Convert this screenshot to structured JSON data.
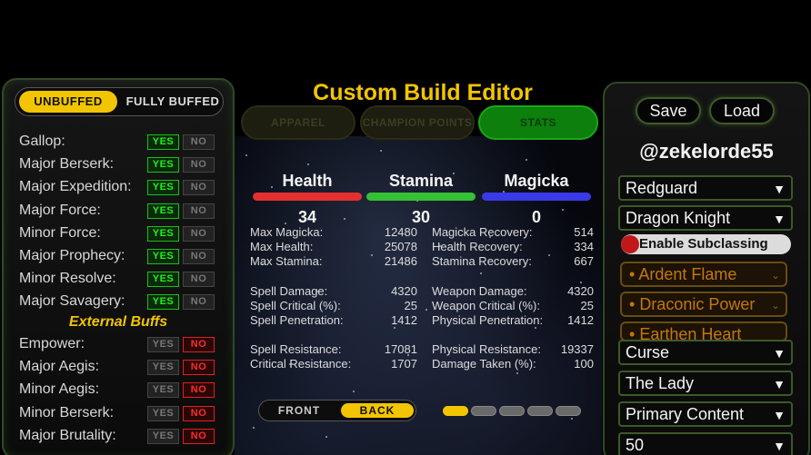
{
  "buff_mode": {
    "unbuffed": "UNBUFFED",
    "fully_buffed": "FULLY BUFFED"
  },
  "yes_label": "YES",
  "no_label": "NO",
  "major_buffs": [
    {
      "label": "Gallop:",
      "value": "yes"
    },
    {
      "label": "Major Berserk:",
      "value": "yes"
    },
    {
      "label": "Major Expedition:",
      "value": "yes"
    },
    {
      "label": "Major Force:",
      "value": "yes"
    },
    {
      "label": "Minor Force:",
      "value": "yes"
    },
    {
      "label": "Major Prophecy:",
      "value": "yes"
    },
    {
      "label": "Minor Resolve:",
      "value": "yes"
    },
    {
      "label": "Major Savagery:",
      "value": "yes"
    }
  ],
  "external_heading": "External Buffs",
  "external_buffs": [
    {
      "label": "Empower:",
      "value": "no"
    },
    {
      "label": "Major Aegis:",
      "value": "no"
    },
    {
      "label": "Minor Aegis:",
      "value": "no"
    },
    {
      "label": "Minor Berserk:",
      "value": "no"
    },
    {
      "label": "Major Brutality:",
      "value": "no"
    }
  ],
  "title": "Custom Build Editor",
  "tabs": [
    "APPAREL",
    "CHAMPION POINTS",
    "STATS"
  ],
  "active_tab": "STATS",
  "attributes": [
    {
      "name": "Health",
      "value": "34",
      "color": "#e53030"
    },
    {
      "name": "Stamina",
      "value": "30",
      "color": "#35c035"
    },
    {
      "name": "Magicka",
      "value": "0",
      "color": "#3a3ae8"
    }
  ],
  "stats_left": [
    [
      {
        "k": "Max Magicka:",
        "v": "12480"
      },
      {
        "k": "Max Health:",
        "v": "25078"
      },
      {
        "k": "Max Stamina:",
        "v": "21486"
      }
    ],
    [
      {
        "k": "Spell Damage:",
        "v": "4320"
      },
      {
        "k": "Spell Critical (%):",
        "v": "25"
      },
      {
        "k": "Spell Penetration:",
        "v": "1412"
      }
    ],
    [
      {
        "k": "Spell Resistance:",
        "v": "17081"
      },
      {
        "k": "Critical Resistance:",
        "v": "1707"
      }
    ]
  ],
  "stats_right": [
    [
      {
        "k": "Magicka Recovery:",
        "v": "514"
      },
      {
        "k": "Health Recovery:",
        "v": "334"
      },
      {
        "k": "Stamina Recovery:",
        "v": "667"
      }
    ],
    [
      {
        "k": "Weapon Damage:",
        "v": "4320"
      },
      {
        "k": "Weapon Critical (%):",
        "v": "25"
      },
      {
        "k": "Physical Penetration:",
        "v": "1412"
      }
    ],
    [
      {
        "k": "Physical Resistance:",
        "v": "19337"
      },
      {
        "k": "Damage Taken (%):",
        "v": "100"
      }
    ]
  ],
  "view_toggle": {
    "front": "FRONT",
    "back": "BACK",
    "selected": "BACK"
  },
  "pagination": {
    "pages": 5,
    "active": 1
  },
  "actions": {
    "save": "Save",
    "load": "Load"
  },
  "username": "@zekelorde55",
  "race": "Redguard",
  "class": "Dragon Knight",
  "subclassing_label": "Enable Subclassing",
  "skill_lines": [
    "Ardent Flame",
    "Draconic Power",
    "Earthen Heart"
  ],
  "mundus": "Curse",
  "boon": "The Lady",
  "content": "Primary Content",
  "level": "50"
}
